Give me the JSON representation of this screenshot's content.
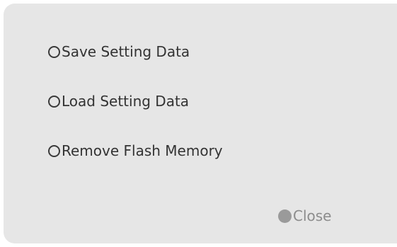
{
  "dialog": {
    "options": [
      {
        "label": "Save Setting Data"
      },
      {
        "label": "Load Setting Data"
      },
      {
        "label": "Remove Flash Memory"
      }
    ],
    "close_label": "Close"
  },
  "icons": {
    "option_marker": "radio-circle-icon",
    "close_marker": "filled-dot-icon"
  },
  "colors": {
    "panel_background": "#e6e6e6",
    "option_text": "#333333",
    "close_text": "#8c8c8c"
  }
}
